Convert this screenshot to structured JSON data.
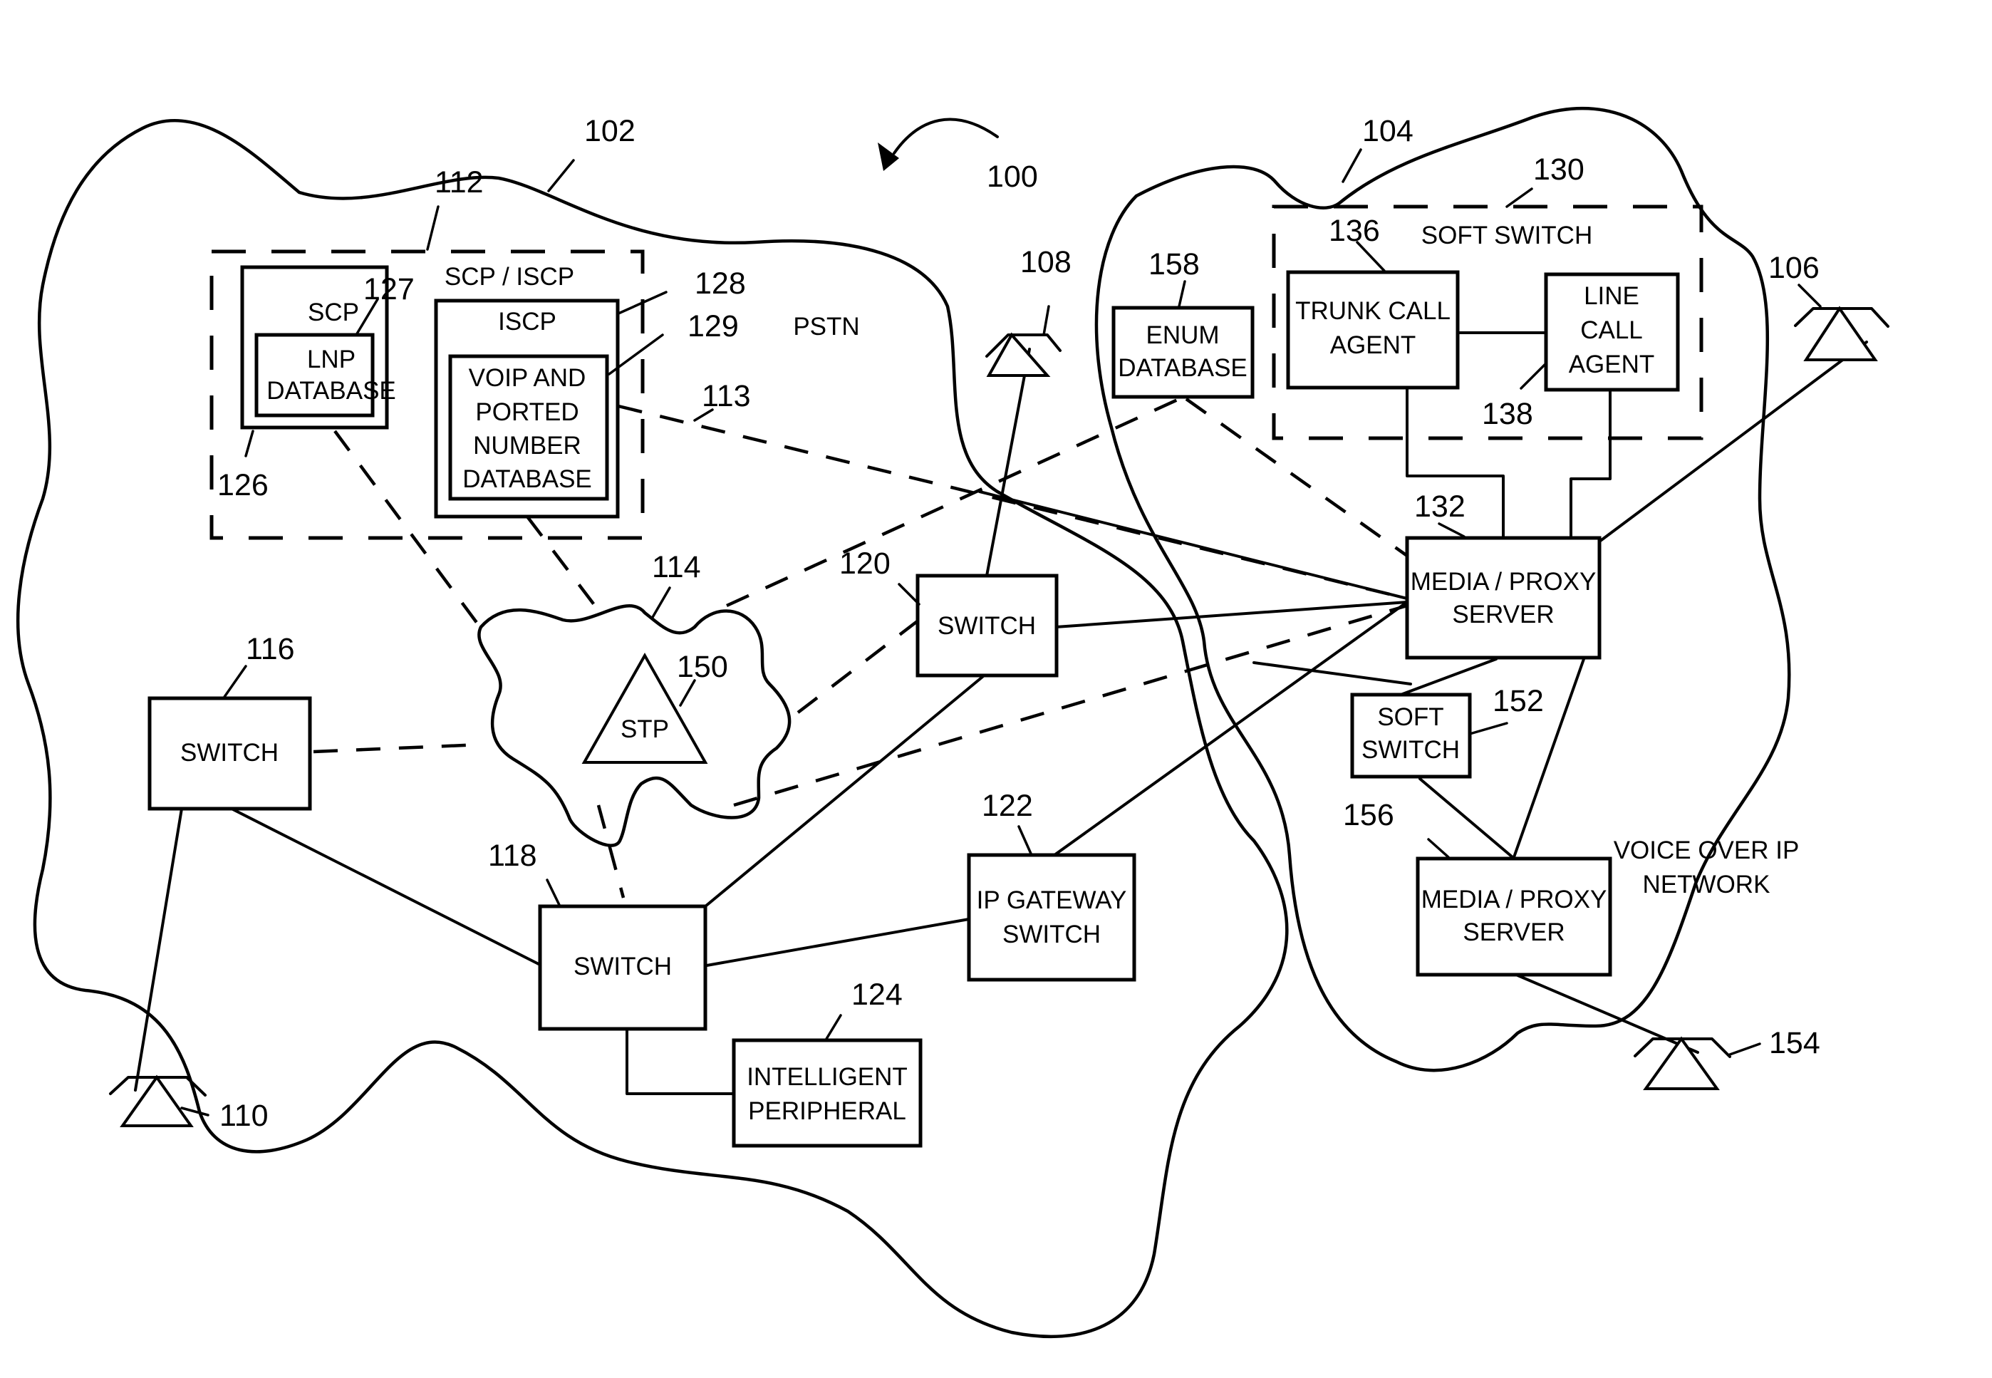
{
  "figure": {
    "ref": "100",
    "networks": {
      "pstn": {
        "ref": "102",
        "label": "PSTN"
      },
      "voip": {
        "ref": "104",
        "label_line1": "VOICE OVER IP",
        "label_line2": "NETWORK"
      }
    },
    "scp_iscp_group": {
      "ref": "112",
      "label": "SCP / ISCP"
    },
    "scp": {
      "ref": "126",
      "label": "SCP"
    },
    "lnp_database": {
      "ref": "127",
      "line1": "LNP",
      "line2": "DATABASE"
    },
    "iscp": {
      "ref": "128",
      "label": "ISCP"
    },
    "voip_ported_db": {
      "ref": "129",
      "line1": "VOIP AND",
      "line2": "PORTED",
      "line3": "NUMBER",
      "line4": "DATABASE"
    },
    "link_113": {
      "ref": "113"
    },
    "stp_cloud": {
      "ref": "114"
    },
    "stp": {
      "ref": "150",
      "label": "STP"
    },
    "switch_116": {
      "ref": "116",
      "label": "SWITCH"
    },
    "switch_118": {
      "ref": "118",
      "label": "SWITCH"
    },
    "switch_120": {
      "ref": "120",
      "label": "SWITCH"
    },
    "ip_gateway": {
      "ref": "122",
      "line1": "IP GATEWAY",
      "line2": "SWITCH"
    },
    "intelligent_peripheral": {
      "ref": "124",
      "line1": "INTELLIGENT",
      "line2": "PERIPHERAL"
    },
    "soft_switch_group": {
      "ref": "130",
      "label": "SOFT SWITCH"
    },
    "trunk_call_agent": {
      "ref": "136",
      "line1": "TRUNK CALL",
      "line2": "AGENT"
    },
    "line_call_agent": {
      "ref": "138",
      "line1": "LINE",
      "line2": "CALL",
      "line3": "AGENT"
    },
    "enum_database": {
      "ref": "158",
      "line1": "ENUM",
      "line2": "DATABASE"
    },
    "media_proxy_132": {
      "ref": "132",
      "line1": "MEDIA / PROXY",
      "line2": "SERVER"
    },
    "soft_switch_152": {
      "ref": "152",
      "line1": "SOFT",
      "line2": "SWITCH"
    },
    "media_proxy_156": {
      "ref": "156",
      "line1": "MEDIA / PROXY",
      "line2": "SERVER"
    },
    "phones": {
      "phone_106": {
        "ref": "106"
      },
      "phone_108": {
        "ref": "108"
      },
      "phone_110": {
        "ref": "110"
      },
      "phone_154": {
        "ref": "154"
      }
    }
  }
}
